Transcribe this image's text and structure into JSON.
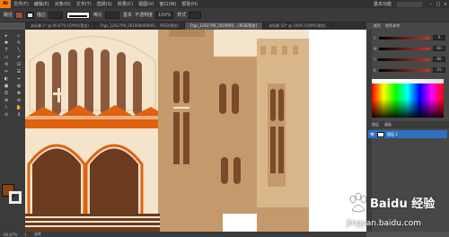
{
  "menubar": {
    "logo": "Ai",
    "items": [
      "文件(F)",
      "编辑(E)",
      "对象(O)",
      "文字(T)",
      "选择(S)",
      "效果(C)",
      "视图(V)",
      "窗口(W)",
      "帮助(H)"
    ],
    "workspace": "基本功能",
    "window_buttons": [
      "–",
      "□",
      "×"
    ]
  },
  "controlbar": {
    "selection_label": "路径",
    "stroke_label": "描边",
    "uniform": "等比",
    "basic": "基本",
    "opacity_label": "不透明度",
    "opacity": "100%",
    "style_label": "样式"
  },
  "tabs": [
    {
      "label": "未标题-1* @ 66.67% (CMYK/预览)",
      "active": false
    },
    {
      "label": "Ftgs_1262799_201909060905... (RGB/预览)",
      "active": false
    },
    {
      "label": "Ftgs_1262799_2019090... (RGB/预览)",
      "active": true
    },
    {
      "label": "未标题-52* @ 100% (CMYK/预览)",
      "active": false
    }
  ],
  "tools": [
    "▸",
    "▹",
    "✱",
    "✎",
    "T",
    "╲",
    "▭",
    "✐",
    "⟲",
    "⊡",
    "✂",
    "☰",
    "◐",
    "⌖",
    "▣",
    "◍",
    "⎚",
    "✥",
    "⊕",
    "⊘",
    "⌇",
    "✋",
    "⊙",
    "↕"
  ],
  "color_panel": {
    "tabs": [
      "颜色",
      "颜色参考"
    ],
    "channels": [
      {
        "name": "C",
        "value": "0"
      },
      {
        "name": "M",
        "value": "60"
      },
      {
        "name": "Y",
        "value": "80"
      },
      {
        "name": "K",
        "value": "25"
      }
    ]
  },
  "layers_panel": {
    "tabs": [
      "图层",
      "画板"
    ],
    "layer_name": "图层 1"
  },
  "statusbar": {
    "zoom": "66.67%",
    "page": "1",
    "tool": "选择"
  },
  "colors": {
    "illustration_cream": "#f3e4cb",
    "illustration_brown": "#6b3a1f",
    "illustration_tan": "#c49a6c",
    "illustration_orange": "#e0620f"
  },
  "watermark": {
    "brand": "Baidu 经验",
    "url": "jingyan.baidu.com"
  }
}
